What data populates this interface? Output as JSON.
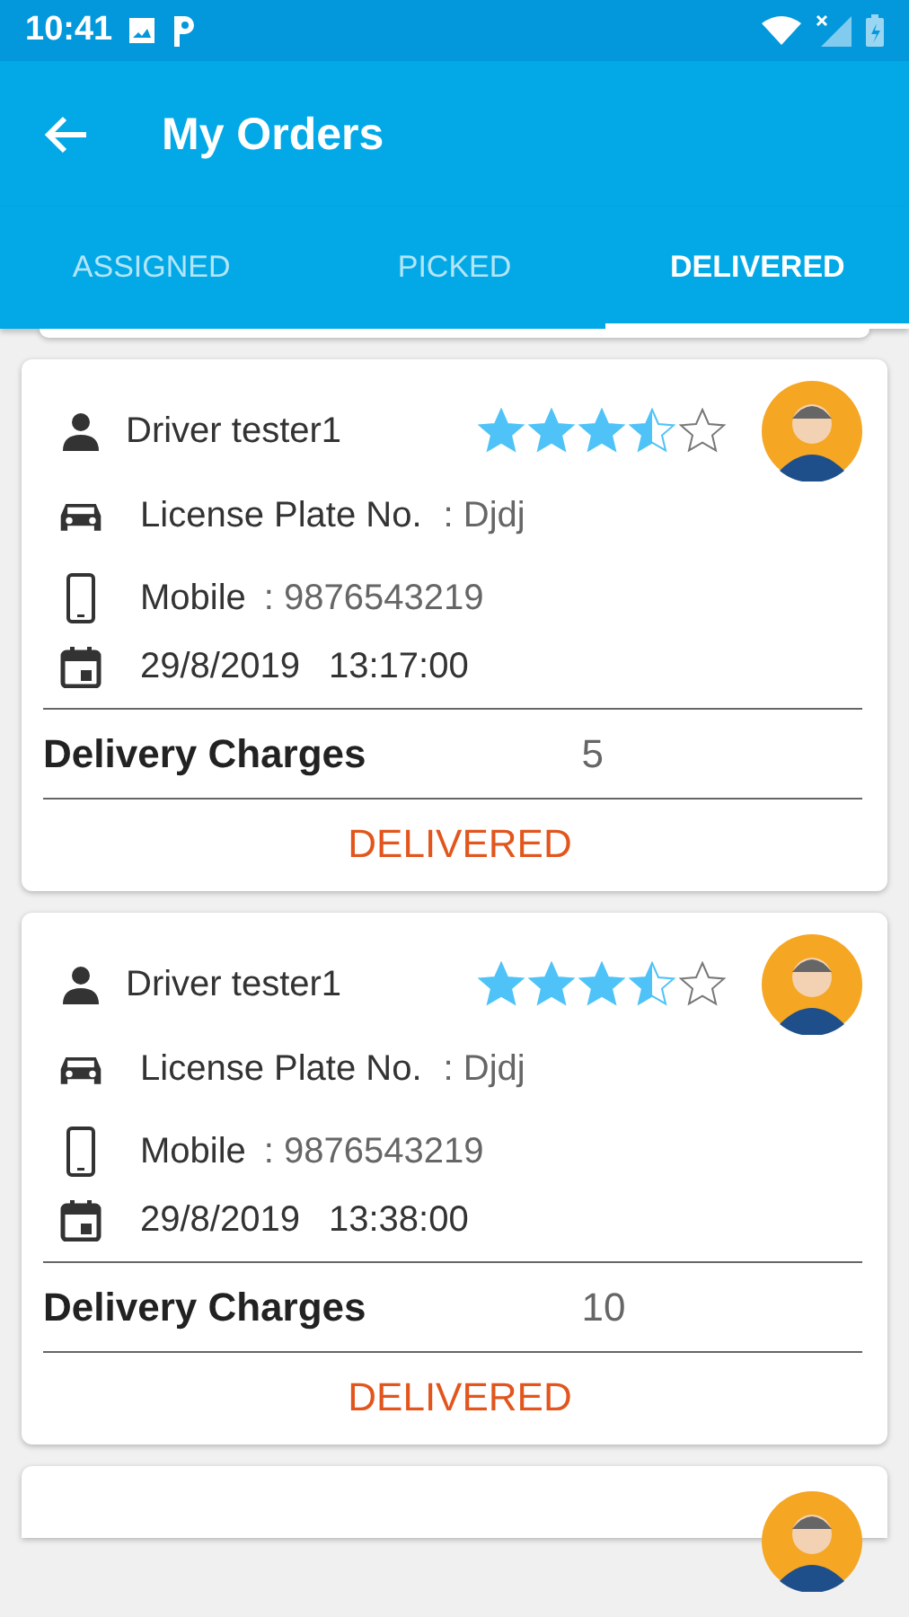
{
  "status_bar": {
    "time": "10:41"
  },
  "app_bar": {
    "title": "My Orders"
  },
  "tabs": [
    {
      "label": "ASSIGNED",
      "selected": false
    },
    {
      "label": "PICKED",
      "selected": false
    },
    {
      "label": "DELIVERED",
      "selected": true
    }
  ],
  "orders": [
    {
      "kind": "full",
      "driver": "Driver tester1",
      "stars": 3.5,
      "plate_label": "License Plate No.",
      "plate": ": Djdj",
      "mobile_label": "Mobile",
      "mobile": ": 9876543219",
      "date": "29/8/2019",
      "time": "13:17:00",
      "charges_label": "Delivery Charges",
      "charges": "5",
      "status": "DELIVERED"
    },
    {
      "kind": "full",
      "driver": "Driver tester1",
      "stars": 3.5,
      "plate_label": "License Plate No.",
      "plate": ": Djdj",
      "mobile_label": "Mobile",
      "mobile": ": 9876543219",
      "date": "29/8/2019",
      "time": "13:38:00",
      "charges_label": "Delivery Charges",
      "charges": "10",
      "status": "DELIVERED"
    },
    {
      "kind": "partial"
    }
  ]
}
